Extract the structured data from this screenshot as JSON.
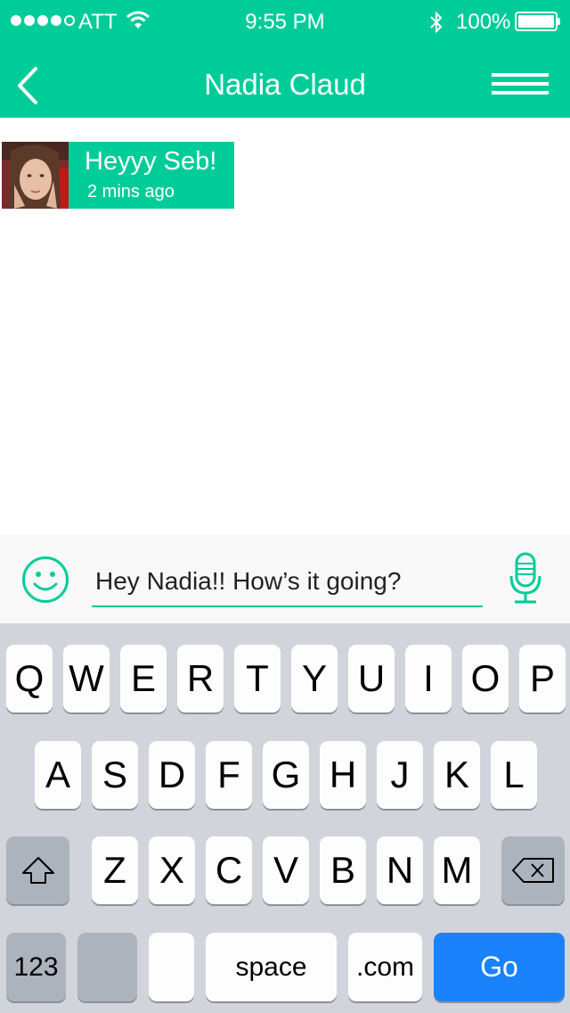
{
  "status_bar": {
    "carrier": "ATT",
    "time": "9:55 PM",
    "battery_percent": "100%",
    "signal_strength": 4,
    "icons": [
      "signal-dots-icon",
      "wifi-icon",
      "bluetooth-icon",
      "battery-icon"
    ]
  },
  "nav": {
    "title": "Nadia Claud",
    "back_icon": "chevron-left-icon",
    "menu_icon": "menu-lines-icon"
  },
  "messages": [
    {
      "text": "Heyyy Seb!",
      "time": "2 mins ago",
      "avatar_icon": "avatar-photo"
    }
  ],
  "composer": {
    "input_value": "Hey Nadia!! How’s it going?",
    "emoji_icon": "smiley-icon",
    "mic_icon": "microphone-icon"
  },
  "keyboard": {
    "row1": [
      "Q",
      "W",
      "E",
      "R",
      "T",
      "Y",
      "U",
      "I",
      "O",
      "P"
    ],
    "row2": [
      "A",
      "S",
      "D",
      "F",
      "G",
      "H",
      "J",
      "K",
      "L"
    ],
    "row3": [
      "Z",
      "X",
      "C",
      "V",
      "B",
      "N",
      "M"
    ],
    "numbers_label": "123",
    "space_label": "space",
    "dotcom_label": ".com",
    "go_label": "Go",
    "shift_icon": "shift-icon",
    "delete_icon": "backspace-icon"
  },
  "colors": {
    "accent": "#00cc99",
    "keyboard_bg": "#d1d5db",
    "go_key": "#1a82fb"
  }
}
